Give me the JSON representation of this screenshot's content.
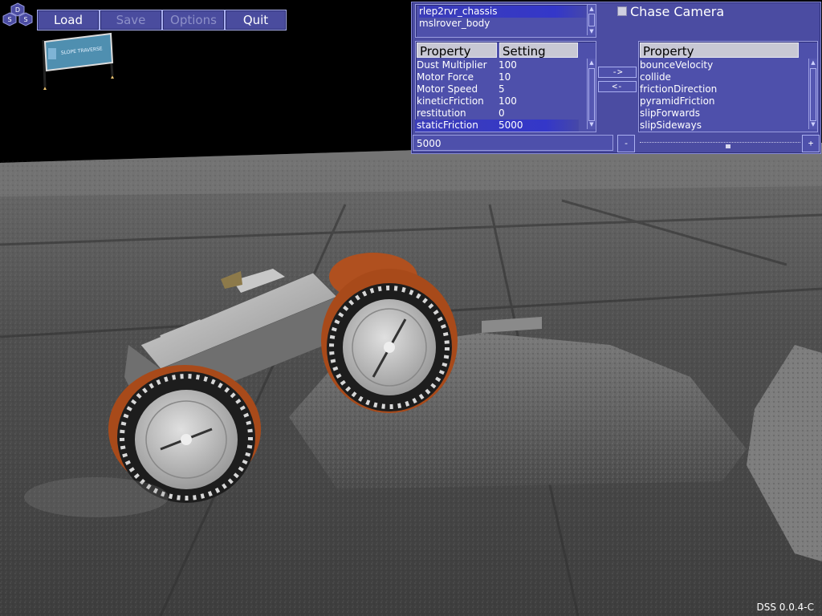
{
  "app": {
    "version": "DSS 0.0.4-C"
  },
  "logo": {
    "letters": [
      "D",
      "S",
      "S"
    ],
    "sign_text": "SLOPE TRAVERSE"
  },
  "menu": {
    "load": "Load",
    "save": "Save",
    "options": "Options",
    "quit": "Quit"
  },
  "objects": [
    {
      "label": "rlep2rvr_chassis",
      "selected": true
    },
    {
      "label": "mslrover_body",
      "selected": false
    }
  ],
  "chase_camera": {
    "label": "Chase Camera",
    "checked": false
  },
  "left_table": {
    "headers": {
      "property": "Property",
      "setting": "Setting"
    },
    "rows": [
      {
        "property": "Dust Multiplier",
        "setting": "100",
        "selected": false
      },
      {
        "property": "Motor Force",
        "setting": "10",
        "selected": false
      },
      {
        "property": "Motor Speed",
        "setting": "5",
        "selected": false
      },
      {
        "property": "kineticFriction",
        "setting": "100",
        "selected": false
      },
      {
        "property": "restitution",
        "setting": "0",
        "selected": false
      },
      {
        "property": "staticFriction",
        "setting": "5000",
        "selected": true
      }
    ]
  },
  "transfer": {
    "add": "->",
    "remove": "<-"
  },
  "right_table": {
    "header": "Property",
    "rows": [
      "bounceVelocity",
      "collide",
      "frictionDirection",
      "pyramidFriction",
      "slipForwards",
      "slipSideways"
    ]
  },
  "value_field": {
    "value": "5000"
  },
  "slider": {
    "minus": "-",
    "plus": "+",
    "level": 0.55
  },
  "colors": {
    "panel": "#4b4ca2",
    "selection": "#3437c9",
    "wheel_fender": "#b0501f"
  }
}
